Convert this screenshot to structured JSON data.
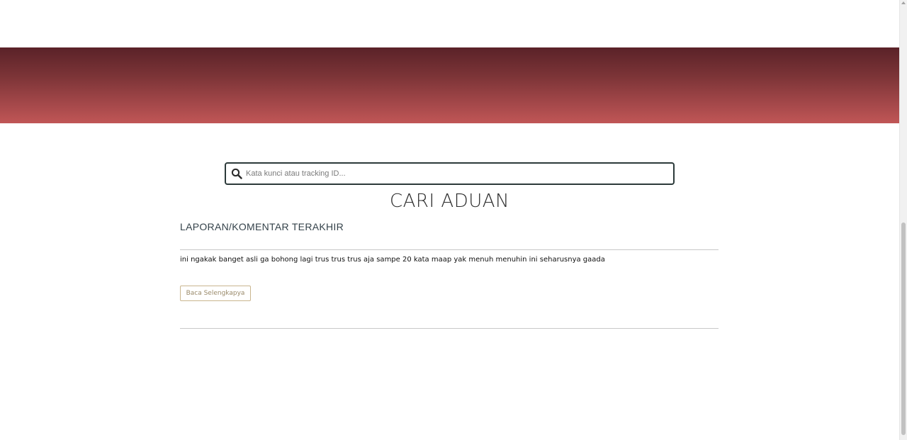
{
  "search": {
    "placeholder": "Kata kunci atau tracking ID...",
    "value": ""
  },
  "page": {
    "title": "CARI ADUAN"
  },
  "latest_reports": {
    "heading": "LAPORAN/KOMENTAR TERAKHIR",
    "items": [
      {
        "text": "ini ngakak banget asli ga bohong lagi trus trus trus aja sampe 20 kata maap yak menuh menuhin ini seharusnya gaada",
        "button_label": "Baca Selengkapya"
      }
    ]
  },
  "colors": {
    "banner_top": "#5a2228",
    "banner_bottom": "#c05656",
    "search_border": "#2c3a3a",
    "button_border": "#c9b58e"
  }
}
